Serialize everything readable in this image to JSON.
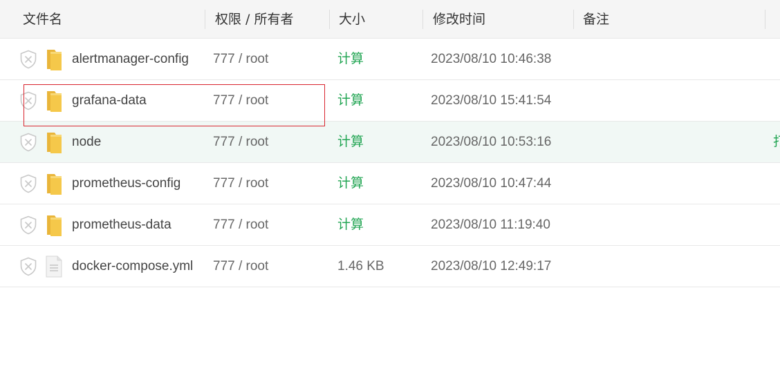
{
  "header": {
    "name": "文件名",
    "perm": "权限 / 所有者",
    "size": "大小",
    "mtime": "修改时间",
    "note": "备注"
  },
  "rows": [
    {
      "name": "alertmanager-config",
      "perm": "777 / root",
      "size": "计算",
      "mtime": "2023/08/10 10:46:38",
      "icon": "folder-icon"
    },
    {
      "name": "grafana-data",
      "perm": "777 / root",
      "size": "计算",
      "mtime": "2023/08/10 15:41:54",
      "icon": "folder-icon"
    },
    {
      "name": "node",
      "perm": "777 / root",
      "size": "计算",
      "mtime": "2023/08/10 10:53:16",
      "icon": "folder-icon",
      "action": "打"
    },
    {
      "name": "prometheus-config",
      "perm": "777 / root",
      "size": "计算",
      "mtime": "2023/08/10 10:47:44",
      "icon": "folder-icon"
    },
    {
      "name": "prometheus-data",
      "perm": "777 / root",
      "size": "计算",
      "mtime": "2023/08/10 11:19:40",
      "icon": "folder-icon"
    },
    {
      "name": "docker-compose.yml",
      "perm": "777 / root",
      "size": "1.46 KB",
      "mtime": "2023/08/10 12:49:17",
      "icon": "file-icon"
    }
  ],
  "colors": {
    "accent_green": "#22a553",
    "header_bg": "#f5f5f5",
    "hover_row_bg": "#f1f8f5",
    "highlight_box": "#d9232d",
    "folder": "#f5c84a"
  }
}
